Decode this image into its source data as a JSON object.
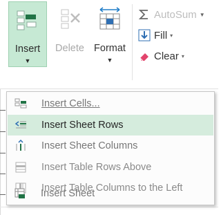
{
  "ribbon": {
    "insert_label": "Insert",
    "delete_label": "Delete",
    "format_label": "Format",
    "autosum_label": "AutoSum",
    "fill_label": "Fill",
    "clear_label": "Clear",
    "dropdown_arrow": "▼",
    "small_caret": "▾"
  },
  "menu": {
    "items": [
      {
        "icon": "insert-cells-icon",
        "label": "Insert Cells...",
        "selected": false,
        "enabled": true
      },
      {
        "icon": "insert-sheet-rows-icon",
        "label": "Insert Sheet Rows",
        "selected": true,
        "enabled": true
      },
      {
        "icon": "insert-sheet-columns-icon",
        "label": "Insert Sheet Columns",
        "selected": false,
        "enabled": true
      },
      {
        "icon": "insert-table-rows-above-icon",
        "label": "Insert Table Rows Above",
        "selected": false,
        "enabled": false
      },
      {
        "icon": "insert-table-columns-left-icon",
        "label": "Insert Table Columns to the Left",
        "selected": false,
        "enabled": false
      },
      {
        "icon": "insert-sheet-icon",
        "label": "Insert Sheet",
        "selected": false,
        "enabled": true
      }
    ]
  },
  "colors": {
    "selected_bg": "#d5ecdd",
    "insert_button_bg": "#c6e9d4",
    "accent_green": "#217346",
    "disabled_text": "#a9a9a9"
  }
}
